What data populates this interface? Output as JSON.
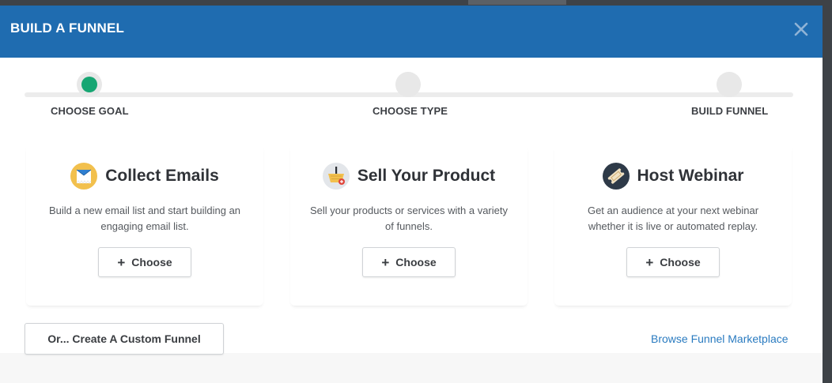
{
  "modal": {
    "title": "BUILD A FUNNEL",
    "close_icon": "close-x-icon"
  },
  "steps": [
    {
      "label": "CHOOSE GOAL",
      "state": "active"
    },
    {
      "label": "CHOOSE TYPE",
      "state": "pending"
    },
    {
      "label": "BUILD FUNNEL",
      "state": "pending"
    }
  ],
  "goals": [
    {
      "title": "Collect Emails",
      "icon": "email-envelope-icon",
      "description": "Build a new email list and start building an engaging email list.",
      "button_label": "Choose"
    },
    {
      "title": "Sell Your Product",
      "icon": "shopping-basket-icon",
      "description": "Sell your products or services with a variety of funnels.",
      "button_label": "Choose"
    },
    {
      "title": "Host Webinar",
      "icon": "ticket-icon",
      "description": "Get an audience at your next webinar whether it is live or automated replay.",
      "button_label": "Choose"
    }
  ],
  "footer": {
    "custom_funnel_label": "Or... Create A Custom Funnel",
    "marketplace_link": "Browse Funnel Marketplace"
  },
  "colors": {
    "header": "#1f6cb0",
    "active_step": "#17a673",
    "link": "#2a7bc0"
  }
}
